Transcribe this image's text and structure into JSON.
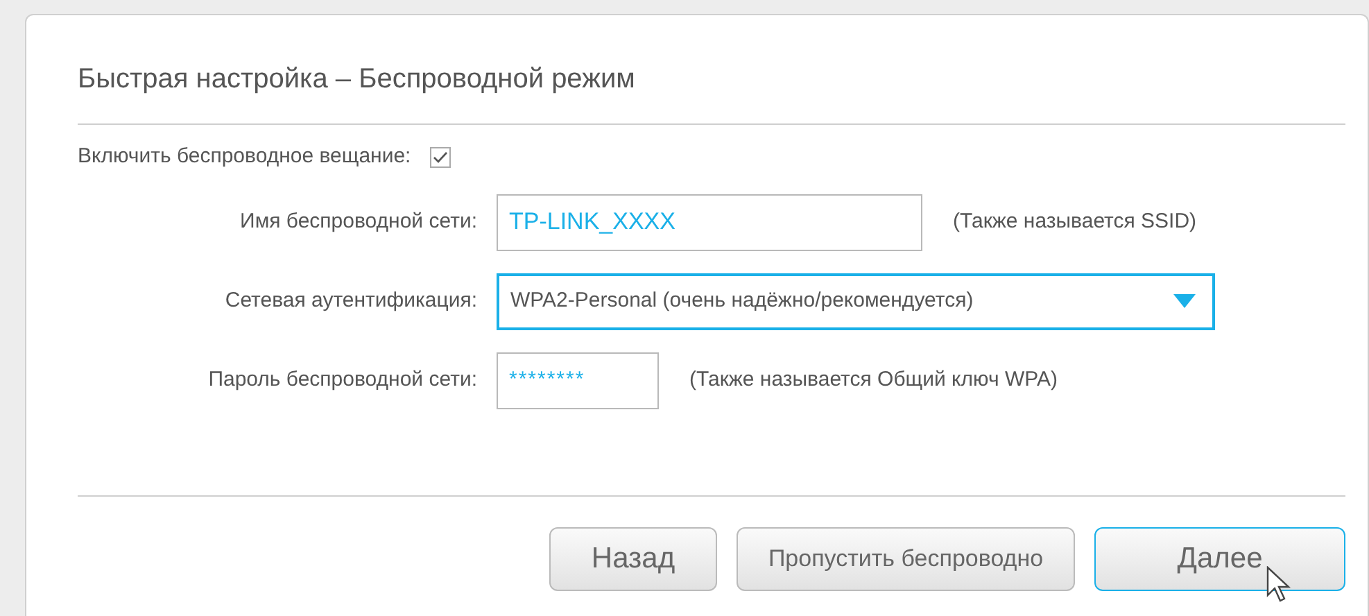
{
  "title": "Быстрая настройка – Беспроводной режим",
  "broadcast": {
    "label": "Включить беспроводное вещание:",
    "checked": true
  },
  "fields": [
    {
      "kind": "text",
      "label": "Имя беспроводной сети:",
      "value": "TP-LINK_XXXX",
      "hint": "(Также называется SSID)",
      "focused": false
    },
    {
      "kind": "select",
      "label": "Сетевая аутентификация:",
      "value": "WPA2-Personal (очень надёжно/рекомендуется)",
      "focused": true
    },
    {
      "kind": "password",
      "label": "Пароль беспроводной сети:",
      "value": "********",
      "hint": "(Также называется Общий ключ WPA)",
      "focused": false
    }
  ],
  "buttons": [
    {
      "label": "Назад",
      "focused": false
    },
    {
      "label": "Пропустить беспроводно",
      "focused": false
    },
    {
      "label": "Далее",
      "focused": true
    }
  ]
}
